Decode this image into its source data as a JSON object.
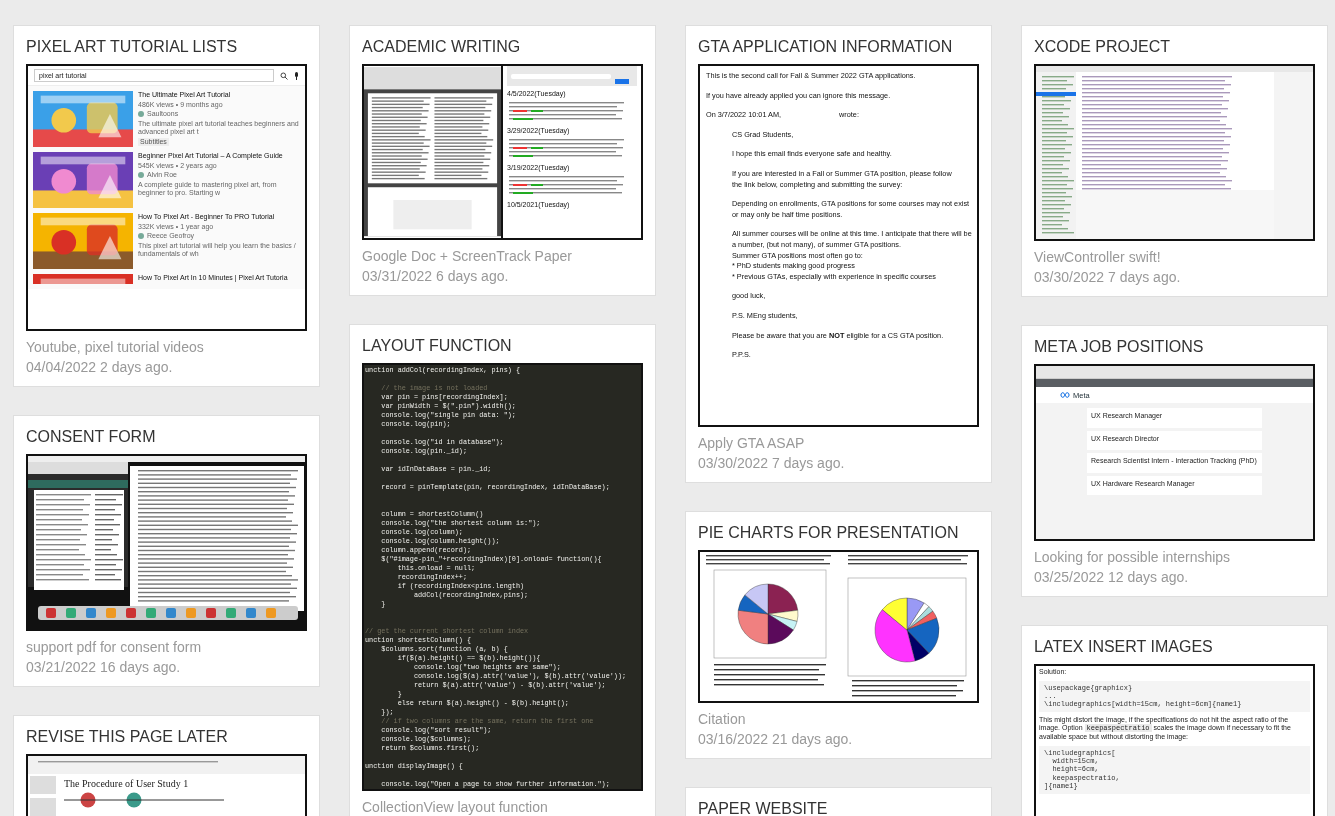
{
  "columns": [
    {
      "cards": [
        {
          "title": "PIXEL ART TUTORIAL LISTS",
          "caption": "Youtube, pixel tutorial videos",
          "date": "04/04/2022 2 days ago.",
          "shot": {
            "kind": "youtube",
            "query": "pixel art tutorial",
            "videos": [
              {
                "title": "The Ultimate Pixel Art Tutorial",
                "meta": "486K views • 9 months ago",
                "channel": "Saultoons",
                "description": "The ultimate pixel art tutorial teaches beginners and advanced pixel art t",
                "badge": "Subtitles"
              },
              {
                "title": "Beginner Pixel Art Tutorial – A Complete Guide",
                "meta": "545K views • 2 years ago",
                "channel": "Alvin Roe",
                "description": "A complete guide to mastering pixel art, from beginner to pro. Starting w"
              },
              {
                "title": "How To Pixel Art - Beginner To PRO Tutorial",
                "meta": "332K views • 1 year ago",
                "channel": "Reece Geofroy",
                "description": "This pixel art tutorial will help you learn the basics / fundamentals of wh"
              },
              {
                "title": "How To Pixel Art In 10 Minutes | Pixel Art Tutoria"
              }
            ]
          }
        },
        {
          "title": "CONSENT FORM",
          "caption": "support pdf for consent form",
          "date": "03/21/2022 16 days ago.",
          "shot": {
            "kind": "desktop"
          }
        },
        {
          "title": "REVISE THIS PAGE LATER",
          "shot": {
            "kind": "slides",
            "heading": "The Procedure of User Study 1"
          }
        }
      ]
    },
    {
      "cards": [
        {
          "title": "ACADEMIC WRITING",
          "caption": "Google Doc + ScreenTrack Paper",
          "date": "03/31/2022 6 days ago.",
          "shot": {
            "kind": "split",
            "headings": [
              "4/5/2022(Tuesday)",
              "3/29/2022(Tuesday)",
              "3/19/2022(Tuesday)",
              "10/5/2021(Tuesday)"
            ]
          }
        },
        {
          "title": "LAYOUT FUNCTION",
          "caption": "CollectionView layout function",
          "shot": {
            "kind": "code",
            "lines": [
              {
                "kind": "code",
                "text": "unction addCol(recordingIndex, pins) {"
              },
              {
                "kind": "blank"
              },
              {
                "kind": "comment",
                "text": "    // the image is not loaded"
              },
              {
                "kind": "code",
                "text": "    var pin = pins[recordingIndex];"
              },
              {
                "kind": "code",
                "text": "    var pinWidth = $(\".pin\").width();"
              },
              {
                "kind": "code",
                "text": "    console.log(\"single pin data: \");"
              },
              {
                "kind": "code",
                "text": "    console.log(pin);"
              },
              {
                "kind": "blank"
              },
              {
                "kind": "code",
                "text": "    console.log(\"id in database\");"
              },
              {
                "kind": "code",
                "text": "    console.log(pin._id);"
              },
              {
                "kind": "blank"
              },
              {
                "kind": "code",
                "text": "    var idInDataBase = pin._id;"
              },
              {
                "kind": "blank"
              },
              {
                "kind": "code",
                "text": "    record = pinTemplate(pin, recordingIndex, idInDataBase);"
              },
              {
                "kind": "blank"
              },
              {
                "kind": "blank"
              },
              {
                "kind": "code",
                "text": "    column = shortestColumn()"
              },
              {
                "kind": "code",
                "text": "    console.log(\"the shortest column is:\");"
              },
              {
                "kind": "code",
                "text": "    console.log(column);"
              },
              {
                "kind": "code",
                "text": "    console.log(column.height());"
              },
              {
                "kind": "code",
                "text": "    column.append(record);"
              },
              {
                "kind": "code",
                "text": "    $(\"#image-pin_\"+recordingIndex)[0].onload= function(){"
              },
              {
                "kind": "code",
                "text": "        this.onload = null;"
              },
              {
                "kind": "code",
                "text": "        recordingIndex++;"
              },
              {
                "kind": "code",
                "text": "        if (recordingIndex<pins.length)"
              },
              {
                "kind": "code",
                "text": "            addCol(recordingIndex,pins);"
              },
              {
                "kind": "code",
                "text": "    }"
              },
              {
                "kind": "blank"
              },
              {
                "kind": "blank"
              },
              {
                "kind": "comment",
                "text": "// get the current shortest column index"
              },
              {
                "kind": "code",
                "text": "unction shortestColumn() {"
              },
              {
                "kind": "code",
                "text": "    $columns.sort(function (a, b) {"
              },
              {
                "kind": "code",
                "text": "        if($(a).height() == $(b).height()){"
              },
              {
                "kind": "code",
                "text": "            console.log(\"two heights are same\");"
              },
              {
                "kind": "code",
                "text": "            console.log($(a).attr('value'), $(b).attr('value'));"
              },
              {
                "kind": "code",
                "text": "            return $(a).attr('value') - $(b).attr('value');"
              },
              {
                "kind": "code",
                "text": "        }"
              },
              {
                "kind": "code",
                "text": "        else return $(a).height() - $(b).height();"
              },
              {
                "kind": "code",
                "text": "    });"
              },
              {
                "kind": "comment",
                "text": "    // if two columns are the same, return the first one"
              },
              {
                "kind": "code",
                "text": "    console.log(\"sort result\");"
              },
              {
                "kind": "code",
                "text": "    console.log($columns);"
              },
              {
                "kind": "code",
                "text": "    return $columns.first();"
              },
              {
                "kind": "blank"
              },
              {
                "kind": "code",
                "text": "unction displayImage() {"
              },
              {
                "kind": "blank"
              },
              {
                "kind": "code",
                "text": "    console.log(\"Open a page to show further information.\");"
              }
            ]
          }
        }
      ]
    },
    {
      "cards": [
        {
          "title": "GTA APPLICATION INFORMATION",
          "caption": "Apply GTA ASAP",
          "date": "03/30/2022 7 days ago.",
          "shot": {
            "kind": "email",
            "paragraphs": [
              {
                "kind": "header",
                "lines": [
                  "This is the second call for Fall & Summer 2022 GTA applications."
                ]
              },
              {
                "kind": "header",
                "lines": [
                  "If you have already applied you can ignore this message."
                ]
              },
              {
                "kind": "attribution",
                "lines": [
                  "On 3/7/2022 10:01 AM,",
                  "wrote:"
                ]
              },
              {
                "kind": "body",
                "lines": [
                  "CS Grad Students,"
                ]
              },
              {
                "kind": "body",
                "lines": [
                  "I hope this email finds everyone safe and healthy."
                ]
              },
              {
                "kind": "body",
                "lines": [
                  "If you are interested in a Fall or Summer GTA position, please follow",
                  "the link below, completing and submitting the survey:"
                ]
              },
              {
                "kind": "body",
                "lines": [
                  "Depending on enrollments, GTA positions for some courses may not exist",
                  "or may only be half time positions."
                ]
              },
              {
                "kind": "body",
                "lines": [
                  "All summer courses will be online at this time. I anticipate that there will be",
                  "a number, (but not many), of summer GTA positions.",
                  "Summer GTA positions most often go to:",
                  "* PhD students making good progress",
                  "* Previous GTAs, especially with experience in specific courses"
                ]
              },
              {
                "kind": "body",
                "lines": [
                  "good luck,"
                ]
              },
              {
                "kind": "body",
                "lines": [
                  "P.S. MEng students,"
                ]
              },
              {
                "kind": "body",
                "lines": [
                  "Please be aware that you are **NOT** eligible for a CS GTA position."
                ]
              },
              {
                "kind": "body",
                "lines": [
                  "P.P.S."
                ]
              }
            ]
          }
        },
        {
          "title": "PIE CHARTS FOR PRESENTATION",
          "caption": "Citation",
          "date": "03/16/2022 21 days ago.",
          "shot": {
            "kind": "paper"
          }
        },
        {
          "title": "PAPER WEBSITE"
        }
      ]
    },
    {
      "cards": [
        {
          "title": "XCODE PROJECT",
          "caption": "ViewController swift!",
          "date": "03/30/2022 7 days ago.",
          "shot": {
            "kind": "ide"
          }
        },
        {
          "title": "META JOB POSITIONS",
          "caption": "Looking for possible internships",
          "date": "03/25/2022 12 days ago.",
          "shot": {
            "kind": "jobs",
            "brand": "Meta",
            "jobs": [
              "UX Research Manager",
              "UX Research Director",
              "Research Scientist Intern - Interaction Tracking (PhD)",
              "UX Hardware Research Manager"
            ]
          }
        },
        {
          "title": "LATEX INSERT IMAGES",
          "shot": {
            "kind": "latex",
            "blocks": [
              {
                "kind": "text",
                "text": "Solution:"
              },
              {
                "kind": "code",
                "lines": [
                  "\\usepackage{graphicx}",
                  "...",
                  "\\includegraphics[width=15cm, height=6cm]{name1}"
                ]
              },
              {
                "kind": "text",
                "text": "This might distort the image, if the specifications do not hit the aspect ratio of the image. Option",
                "code": "keepaspectratio",
                "after": "scales the image down if necessary to fit the available space but without distorting the image:"
              },
              {
                "kind": "code",
                "lines": [
                  "\\includegraphics[",
                  "  width=15cm,",
                  "  height=6cm,",
                  "  keepaspectratio,",
                  "]{name1}"
                ]
              }
            ]
          }
        }
      ]
    }
  ]
}
